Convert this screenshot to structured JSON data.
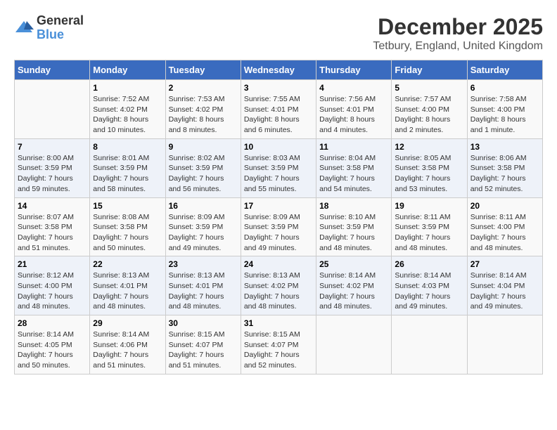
{
  "logo": {
    "general": "General",
    "blue": "Blue"
  },
  "title": "December 2025",
  "subtitle": "Tetbury, England, United Kingdom",
  "days_of_week": [
    "Sunday",
    "Monday",
    "Tuesday",
    "Wednesday",
    "Thursday",
    "Friday",
    "Saturday"
  ],
  "weeks": [
    [
      {
        "day": "",
        "sunrise": "",
        "sunset": "",
        "daylight": ""
      },
      {
        "day": "1",
        "sunrise": "Sunrise: 7:52 AM",
        "sunset": "Sunset: 4:02 PM",
        "daylight": "Daylight: 8 hours and 10 minutes."
      },
      {
        "day": "2",
        "sunrise": "Sunrise: 7:53 AM",
        "sunset": "Sunset: 4:02 PM",
        "daylight": "Daylight: 8 hours and 8 minutes."
      },
      {
        "day": "3",
        "sunrise": "Sunrise: 7:55 AM",
        "sunset": "Sunset: 4:01 PM",
        "daylight": "Daylight: 8 hours and 6 minutes."
      },
      {
        "day": "4",
        "sunrise": "Sunrise: 7:56 AM",
        "sunset": "Sunset: 4:01 PM",
        "daylight": "Daylight: 8 hours and 4 minutes."
      },
      {
        "day": "5",
        "sunrise": "Sunrise: 7:57 AM",
        "sunset": "Sunset: 4:00 PM",
        "daylight": "Daylight: 8 hours and 2 minutes."
      },
      {
        "day": "6",
        "sunrise": "Sunrise: 7:58 AM",
        "sunset": "Sunset: 4:00 PM",
        "daylight": "Daylight: 8 hours and 1 minute."
      }
    ],
    [
      {
        "day": "7",
        "sunrise": "Sunrise: 8:00 AM",
        "sunset": "Sunset: 3:59 PM",
        "daylight": "Daylight: 7 hours and 59 minutes."
      },
      {
        "day": "8",
        "sunrise": "Sunrise: 8:01 AM",
        "sunset": "Sunset: 3:59 PM",
        "daylight": "Daylight: 7 hours and 58 minutes."
      },
      {
        "day": "9",
        "sunrise": "Sunrise: 8:02 AM",
        "sunset": "Sunset: 3:59 PM",
        "daylight": "Daylight: 7 hours and 56 minutes."
      },
      {
        "day": "10",
        "sunrise": "Sunrise: 8:03 AM",
        "sunset": "Sunset: 3:59 PM",
        "daylight": "Daylight: 7 hours and 55 minutes."
      },
      {
        "day": "11",
        "sunrise": "Sunrise: 8:04 AM",
        "sunset": "Sunset: 3:58 PM",
        "daylight": "Daylight: 7 hours and 54 minutes."
      },
      {
        "day": "12",
        "sunrise": "Sunrise: 8:05 AM",
        "sunset": "Sunset: 3:58 PM",
        "daylight": "Daylight: 7 hours and 53 minutes."
      },
      {
        "day": "13",
        "sunrise": "Sunrise: 8:06 AM",
        "sunset": "Sunset: 3:58 PM",
        "daylight": "Daylight: 7 hours and 52 minutes."
      }
    ],
    [
      {
        "day": "14",
        "sunrise": "Sunrise: 8:07 AM",
        "sunset": "Sunset: 3:58 PM",
        "daylight": "Daylight: 7 hours and 51 minutes."
      },
      {
        "day": "15",
        "sunrise": "Sunrise: 8:08 AM",
        "sunset": "Sunset: 3:58 PM",
        "daylight": "Daylight: 7 hours and 50 minutes."
      },
      {
        "day": "16",
        "sunrise": "Sunrise: 8:09 AM",
        "sunset": "Sunset: 3:59 PM",
        "daylight": "Daylight: 7 hours and 49 minutes."
      },
      {
        "day": "17",
        "sunrise": "Sunrise: 8:09 AM",
        "sunset": "Sunset: 3:59 PM",
        "daylight": "Daylight: 7 hours and 49 minutes."
      },
      {
        "day": "18",
        "sunrise": "Sunrise: 8:10 AM",
        "sunset": "Sunset: 3:59 PM",
        "daylight": "Daylight: 7 hours and 48 minutes."
      },
      {
        "day": "19",
        "sunrise": "Sunrise: 8:11 AM",
        "sunset": "Sunset: 3:59 PM",
        "daylight": "Daylight: 7 hours and 48 minutes."
      },
      {
        "day": "20",
        "sunrise": "Sunrise: 8:11 AM",
        "sunset": "Sunset: 4:00 PM",
        "daylight": "Daylight: 7 hours and 48 minutes."
      }
    ],
    [
      {
        "day": "21",
        "sunrise": "Sunrise: 8:12 AM",
        "sunset": "Sunset: 4:00 PM",
        "daylight": "Daylight: 7 hours and 48 minutes."
      },
      {
        "day": "22",
        "sunrise": "Sunrise: 8:13 AM",
        "sunset": "Sunset: 4:01 PM",
        "daylight": "Daylight: 7 hours and 48 minutes."
      },
      {
        "day": "23",
        "sunrise": "Sunrise: 8:13 AM",
        "sunset": "Sunset: 4:01 PM",
        "daylight": "Daylight: 7 hours and 48 minutes."
      },
      {
        "day": "24",
        "sunrise": "Sunrise: 8:13 AM",
        "sunset": "Sunset: 4:02 PM",
        "daylight": "Daylight: 7 hours and 48 minutes."
      },
      {
        "day": "25",
        "sunrise": "Sunrise: 8:14 AM",
        "sunset": "Sunset: 4:02 PM",
        "daylight": "Daylight: 7 hours and 48 minutes."
      },
      {
        "day": "26",
        "sunrise": "Sunrise: 8:14 AM",
        "sunset": "Sunset: 4:03 PM",
        "daylight": "Daylight: 7 hours and 49 minutes."
      },
      {
        "day": "27",
        "sunrise": "Sunrise: 8:14 AM",
        "sunset": "Sunset: 4:04 PM",
        "daylight": "Daylight: 7 hours and 49 minutes."
      }
    ],
    [
      {
        "day": "28",
        "sunrise": "Sunrise: 8:14 AM",
        "sunset": "Sunset: 4:05 PM",
        "daylight": "Daylight: 7 hours and 50 minutes."
      },
      {
        "day": "29",
        "sunrise": "Sunrise: 8:14 AM",
        "sunset": "Sunset: 4:06 PM",
        "daylight": "Daylight: 7 hours and 51 minutes."
      },
      {
        "day": "30",
        "sunrise": "Sunrise: 8:15 AM",
        "sunset": "Sunset: 4:07 PM",
        "daylight": "Daylight: 7 hours and 51 minutes."
      },
      {
        "day": "31",
        "sunrise": "Sunrise: 8:15 AM",
        "sunset": "Sunset: 4:07 PM",
        "daylight": "Daylight: 7 hours and 52 minutes."
      },
      {
        "day": "",
        "sunrise": "",
        "sunset": "",
        "daylight": ""
      },
      {
        "day": "",
        "sunrise": "",
        "sunset": "",
        "daylight": ""
      },
      {
        "day": "",
        "sunrise": "",
        "sunset": "",
        "daylight": ""
      }
    ]
  ]
}
